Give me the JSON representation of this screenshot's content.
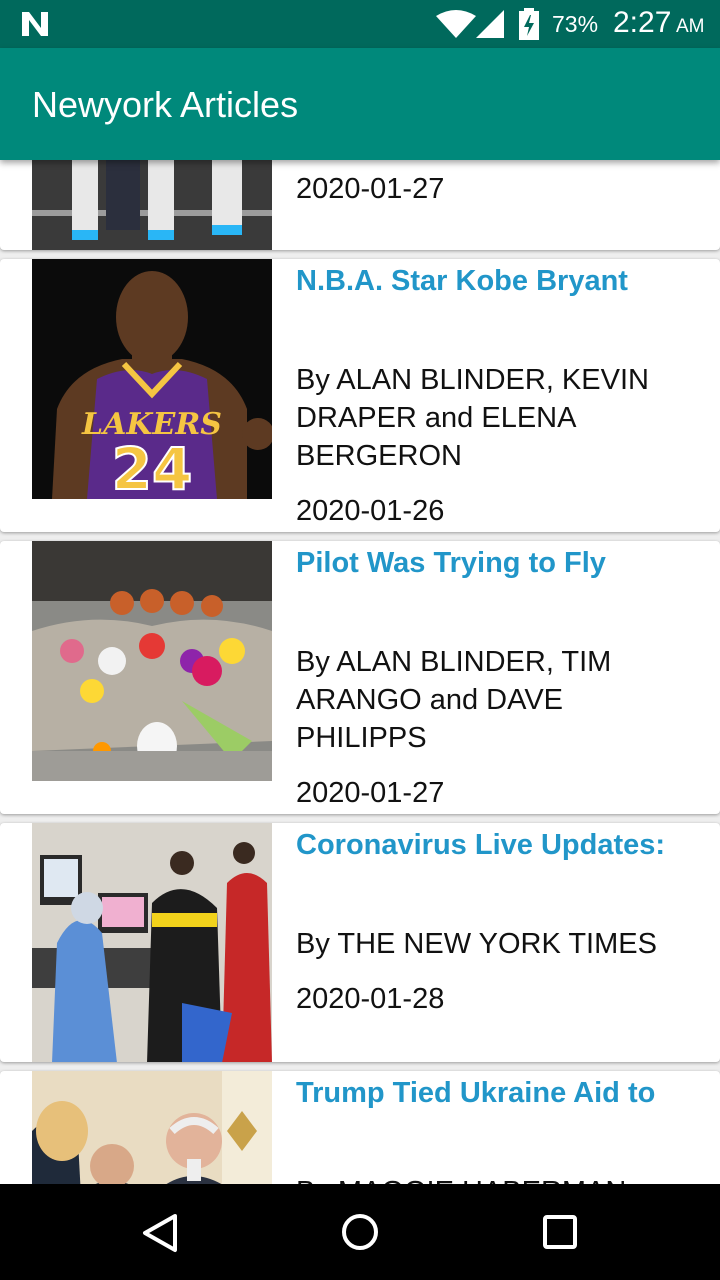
{
  "status_bar": {
    "battery": "73%",
    "time": "2:27",
    "ampm": "AM"
  },
  "app_bar": {
    "title": "Newyork Articles"
  },
  "articles": [
    {
      "title": "",
      "byline": "",
      "date": "2020-01-27"
    },
    {
      "title": "N.B.A. Star Kobe Bryant",
      "byline": "By ALAN BLINDER, KEVIN DRAPER and ELENA BERGERON",
      "date": "2020-01-26"
    },
    {
      "title": "Pilot Was Trying to Fly",
      "byline": "By ALAN BLINDER, TIM ARANGO and DAVE PHILIPPS",
      "date": "2020-01-27"
    },
    {
      "title": "Coronavirus Live Updates:",
      "byline": "By THE NEW YORK TIMES",
      "date": "2020-01-28"
    },
    {
      "title": "Trump Tied Ukraine Aid to",
      "byline": "By MAGGIE HABERMAN",
      "date": ""
    }
  ],
  "colors": {
    "status_bar": "#00695c",
    "app_bar": "#00897b",
    "title_link": "#2196c9"
  }
}
